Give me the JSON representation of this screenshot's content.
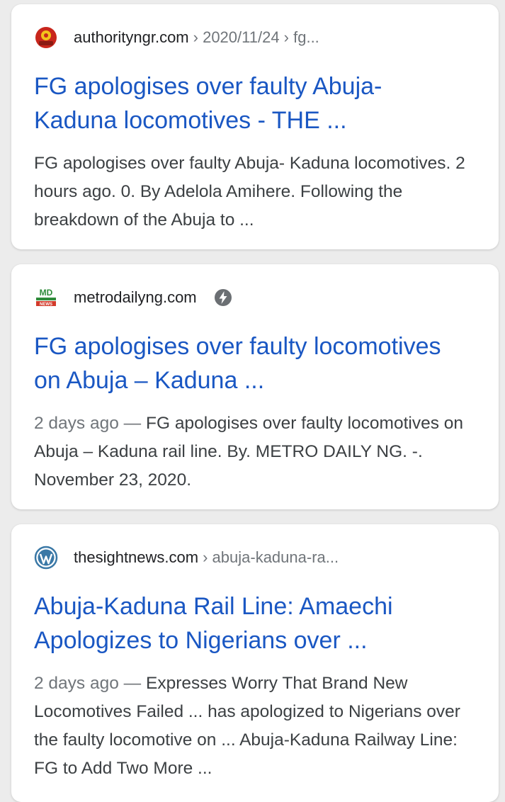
{
  "results": [
    {
      "site": "authorityngr.com",
      "crumb": "› 2020/11/24 › fg...",
      "favicon": "authority-seal-icon",
      "title_line1": "FG apologises over faulty Abuja-",
      "title_line2": "Kaduna locomotives - THE ...",
      "date": "",
      "snippet": "FG apologises over faulty Abuja- Kaduna locomotives. 2 hours ago. 0. By Adelola Amihere. Following the breakdown of the Abuja to ..."
    },
    {
      "site": "metrodailyng.com",
      "crumb": "",
      "favicon": "md-news-logo-icon",
      "badge": "amp-lightning-icon",
      "title_line1": "FG apologises over faulty locomotives",
      "title_line2": "on Abuja – Kaduna ...",
      "date": "2 days ago",
      "separator": " — ",
      "snippet": "FG apologises over faulty locomotives on Abuja – Kaduna rail line. By. METRO DAILY NG. -. November 23, 2020."
    },
    {
      "site": "thesightnews.com",
      "crumb": "› abuja-kaduna-ra...",
      "favicon": "wordpress-icon",
      "title_line1": "Abuja-Kaduna Rail Line: Amaechi",
      "title_line2": "Apologizes to Nigerians over ...",
      "date": "2 days ago",
      "separator": " — ",
      "snippet": "Expresses Worry That Brand New Locomotives Failed ... has apologized to Nigerians over the faulty locomotive on ... Abuja-Kaduna Railway Line: FG to Add Two More ..."
    }
  ],
  "colors": {
    "link": "#1a57c3",
    "text": "#3c4043",
    "meta": "#70757a",
    "background": "#ececec"
  },
  "favicon_text": {
    "md_top": "MD",
    "md_bottom": "NEWS"
  }
}
